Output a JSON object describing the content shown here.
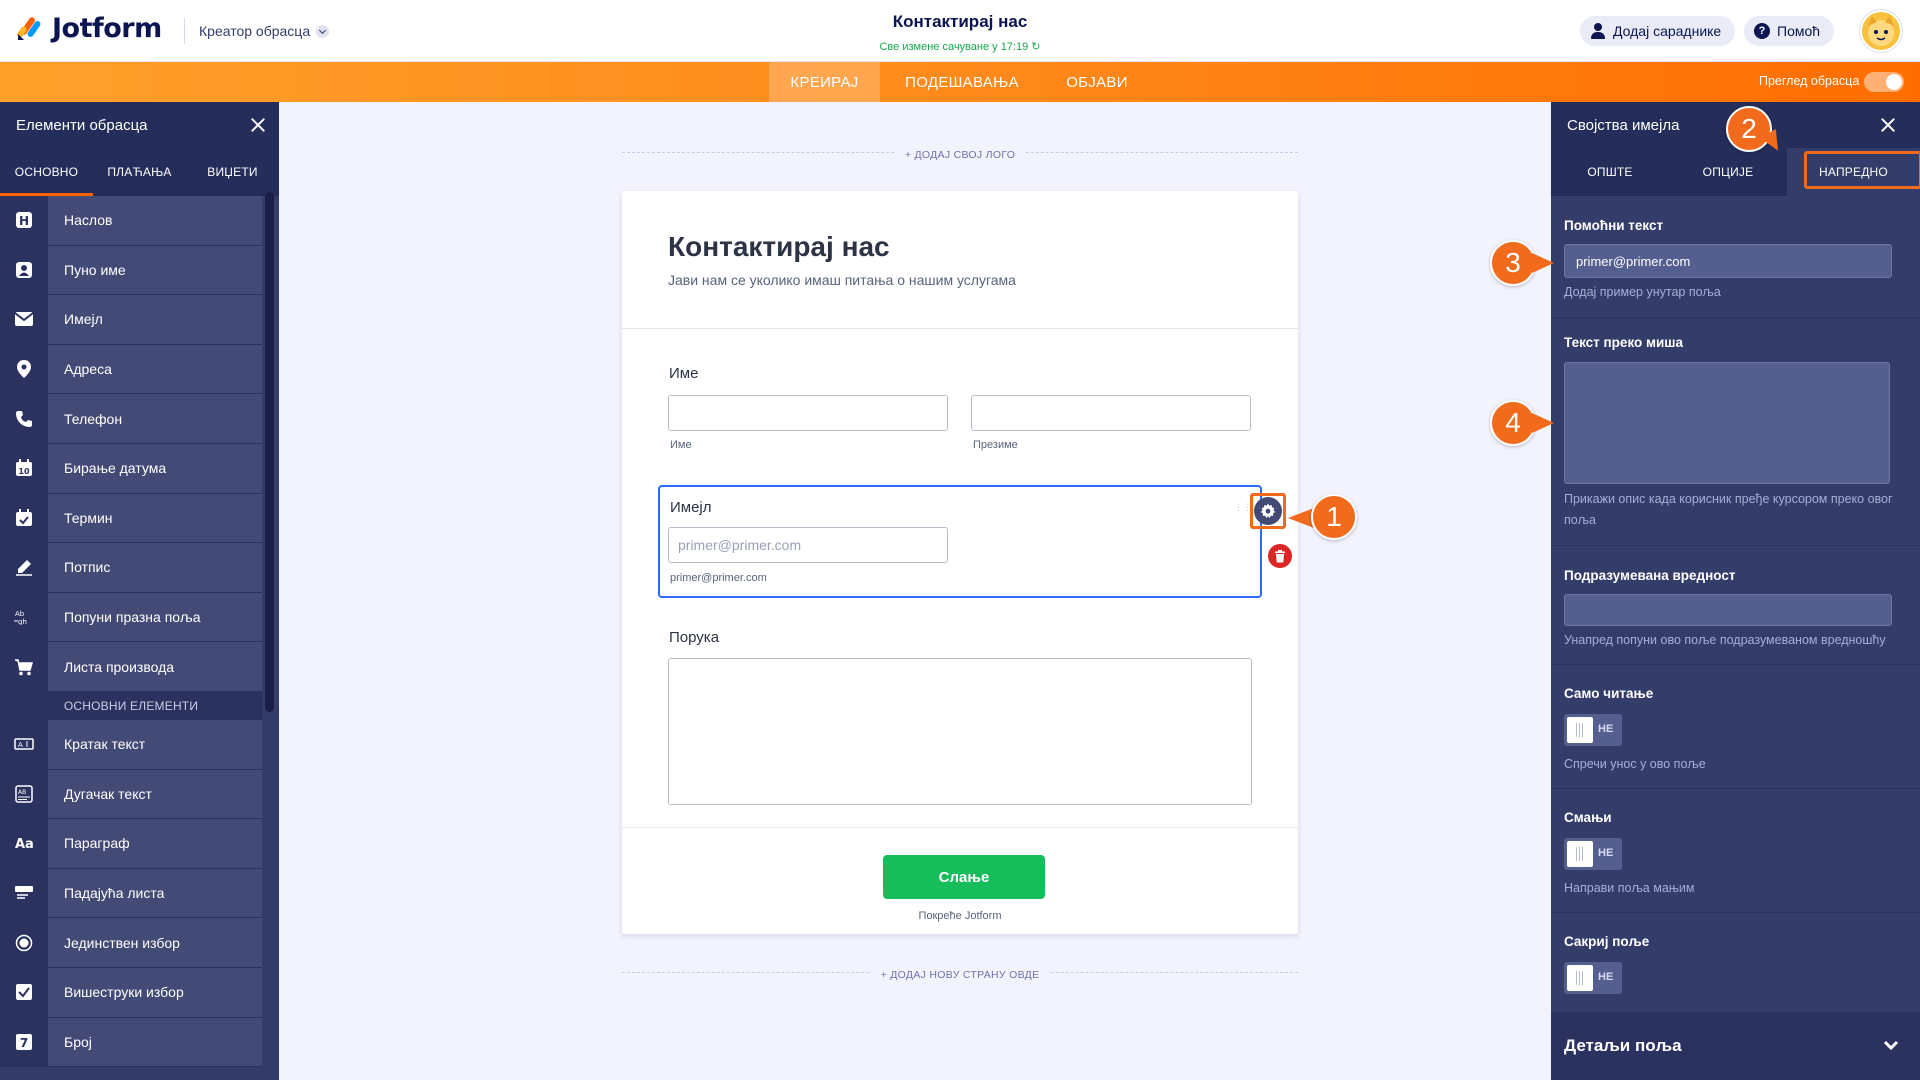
{
  "colors": {
    "brand_orange": "#ff6100",
    "submit_green": "#18bd5b",
    "focus_blue": "#2e69ff",
    "panel_dark": "#343c6a",
    "callout_orange": "#f26b1d"
  },
  "header": {
    "logo_text": "Jotform",
    "builder_dropdown": "Креатор обрасца",
    "form_title": "Контактирај нас",
    "saved_status": "Све измене сачуване у 17:19",
    "invite_button": "Додај сараднике",
    "help_button": "Помоћ"
  },
  "navbar": {
    "tabs": [
      "КРЕИРАЈ",
      "ПОДЕШАВАЊА",
      "ОБЈАВИ"
    ],
    "active_tab": "КРЕИРАЈ",
    "preview_label": "Преглед обрасца"
  },
  "left_panel": {
    "title": "Елементи обрасца",
    "tabs": [
      "ОСНОВНО",
      "ПЛАЋАЊА",
      "ВИЏЕТИ"
    ],
    "items_basic": [
      "Наслов",
      "Пуно име",
      "Имејл",
      "Адреса",
      "Телефон",
      "Бирање датума",
      "Термин",
      "Потпис",
      "Попуни празна поља",
      "Листа производа"
    ],
    "section_label": "ОСНОВНИ ЕЛЕМЕНТИ",
    "items_elements": [
      "Кратак текст",
      "Дугачак текст",
      "Параграф",
      "Падајућа листа",
      "Јединствен избор",
      "Вишеструки избор",
      "Број"
    ]
  },
  "canvas": {
    "add_logo": "+ ДОДАЈ СВОЈ ЛОГО",
    "add_page": "+ ДОДАЈ НОВУ СТРАНУ ОВДЕ",
    "form": {
      "heading": "Контактирај нас",
      "subheading": "Јави нам се уколико имаш питања о нашим услугама",
      "name_label": "Име",
      "first_sublabel": "Име",
      "last_sublabel": "Презиме",
      "email_label": "Имејл",
      "email_placeholder": "primer@primer.com",
      "email_sublabel": "primer@primer.com",
      "message_label": "Порука",
      "submit": "Слање",
      "powered_by": "Покреће Jotform"
    }
  },
  "right_panel": {
    "title": "Својства имејла",
    "tabs": [
      "ОПШТЕ",
      "ОПЦИЈЕ",
      "НАПРЕДНО"
    ],
    "active_tab": "НАПРЕДНО",
    "hint_label": "Помоћни текст",
    "hint_value": "primer@primer.com",
    "hint_help": "Додај пример унутар поља",
    "hover_label": "Текст преко миша",
    "hover_help": "Прикажи опис када корисник пређе курсором преко овог поља",
    "default_label": "Подразумевана вредност",
    "default_help": "Унапред попуни ово поље подразумеваном вредношћу",
    "readonly_label": "Само читање",
    "readonly_state": "НЕ",
    "readonly_help": "Спречи унос у ово поље",
    "shrink_label": "Смањи",
    "shrink_state": "НЕ",
    "shrink_help": "Направи поља мањим",
    "hide_label": "Сакриј поље",
    "hide_state": "НЕ",
    "field_details": "Детаљи поља"
  },
  "callouts": [
    "1",
    "2",
    "3",
    "4"
  ]
}
